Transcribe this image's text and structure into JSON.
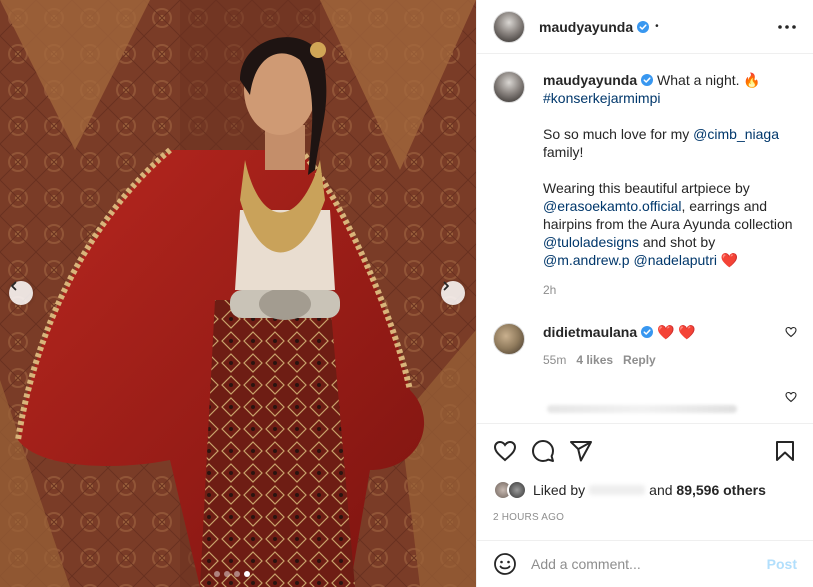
{
  "post": {
    "carousel": {
      "total_slides": 4,
      "active_slide": 4
    },
    "author": {
      "username": "maudyayunda",
      "dot": "•"
    },
    "caption": {
      "username": "maudyayunda",
      "line1_text": " What a night. 🔥",
      "hashtag": "#konserkejarmimpi",
      "p2_pre": "So so much love for my ",
      "p2_mention": "@cimb_niaga",
      "p2_post": " family!",
      "p3_pre": "Wearing this beautiful artpiece by ",
      "p3_mention1": "@erasoekamto.official",
      "p3_mid1": ", earrings and hairpins from the Aura Ayunda collection ",
      "p3_mention2": "@tuloladesigns",
      "p3_mid2": " and shot by ",
      "p3_mention3": "@m.andrew.p",
      "p3_mid3": " ",
      "p3_mention4": "@nadelaputri",
      "p3_end": " ❤️",
      "time": "2h"
    },
    "comment": {
      "username": "didietmaulana",
      "text": " ❤️ ❤️",
      "time": "55m",
      "likes": "4 likes",
      "reply": "Reply"
    },
    "likes": {
      "prefix": "Liked by",
      "and": "and",
      "count": "89,596 others"
    },
    "timestamp": "2 HOURS AGO",
    "add_comment": {
      "placeholder": "Add a comment...",
      "post_label": "Post"
    }
  },
  "colors": {
    "link": "#00376b",
    "verified": "#3897f0",
    "heart": "#ed4956",
    "post_disabled": "#b2dffc"
  }
}
